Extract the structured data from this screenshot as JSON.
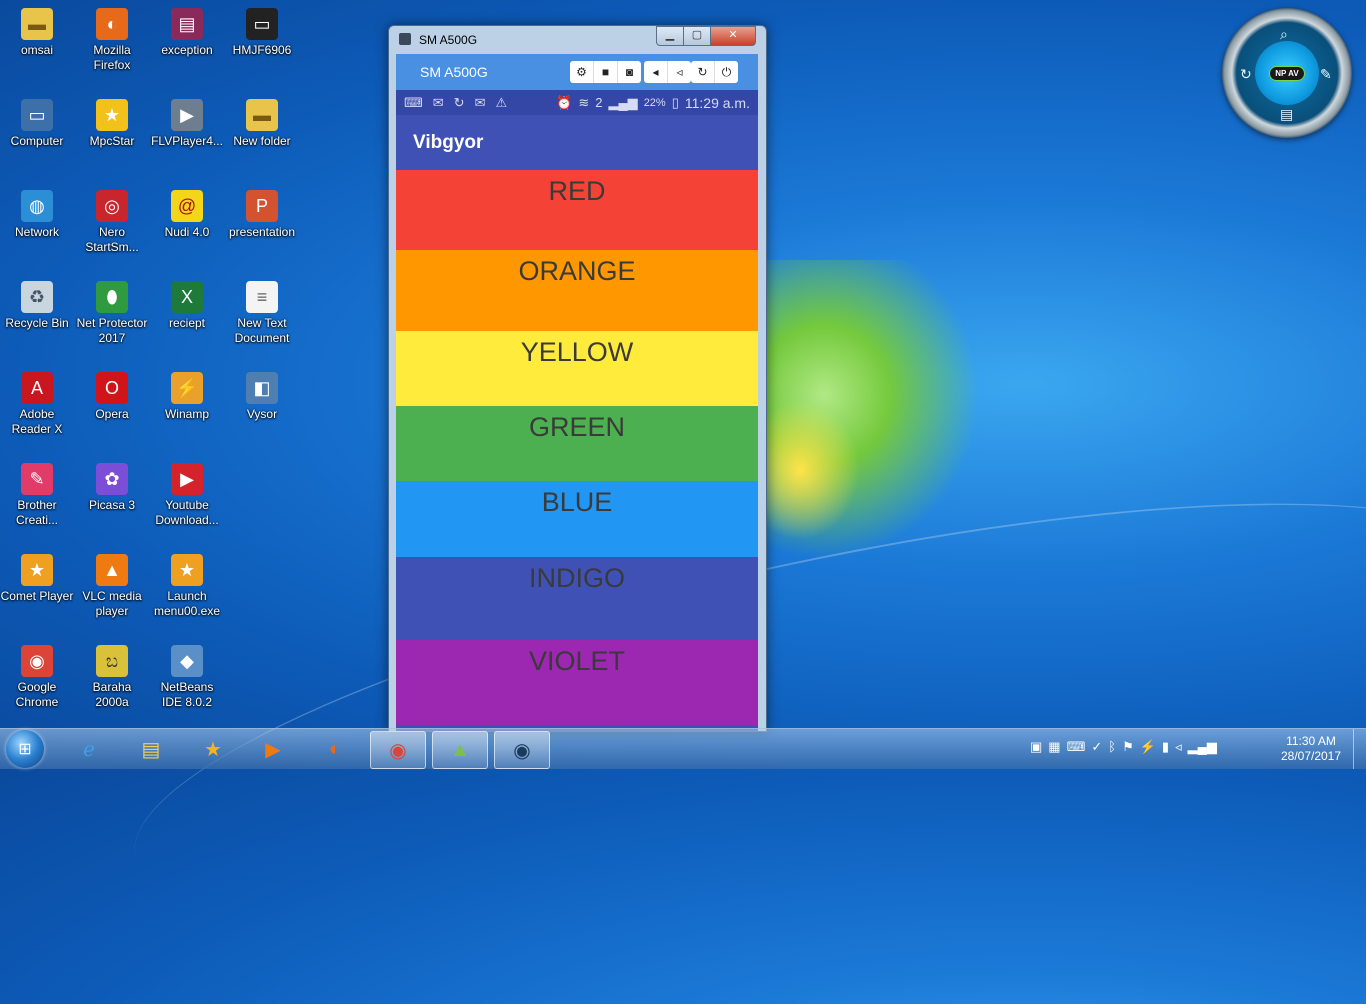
{
  "desktop": {
    "icons": [
      {
        "label": "omsai",
        "icon": "folder-icon"
      },
      {
        "label": "Mozilla Firefox",
        "icon": "firefox-icon"
      },
      {
        "label": "exception",
        "icon": "winrar-icon"
      },
      {
        "label": "HMJF6906",
        "icon": "device-icon"
      },
      {
        "label": "Computer",
        "icon": "computer-icon"
      },
      {
        "label": "MpcStar",
        "icon": "mpcstar-icon"
      },
      {
        "label": "FLVPlayer4...",
        "icon": "flvplayer-icon"
      },
      {
        "label": "New folder",
        "icon": "folder-icon"
      },
      {
        "label": "Network",
        "icon": "network-icon"
      },
      {
        "label": "Nero StartSm...",
        "icon": "nero-icon"
      },
      {
        "label": "Nudi 4.0",
        "icon": "nudi-icon"
      },
      {
        "label": "presentation",
        "icon": "powerpoint-icon"
      },
      {
        "label": "Recycle Bin",
        "icon": "recycle-bin-icon"
      },
      {
        "label": "Net Protector 2017",
        "icon": "net-protector-icon"
      },
      {
        "label": "reciept",
        "icon": "excel-icon"
      },
      {
        "label": "New Text Document",
        "icon": "text-document-icon"
      },
      {
        "label": "Adobe Reader X",
        "icon": "adobe-reader-icon"
      },
      {
        "label": "Opera",
        "icon": "opera-icon"
      },
      {
        "label": "Winamp",
        "icon": "winamp-icon"
      },
      {
        "label": "Vysor",
        "icon": "vysor-icon"
      },
      {
        "label": "Brother Creati...",
        "icon": "brother-icon"
      },
      {
        "label": "Picasa 3",
        "icon": "picasa-icon"
      },
      {
        "label": "Youtube Download...",
        "icon": "youtube-downloader-icon"
      },
      {
        "label": "Comet Player",
        "icon": "comet-player-icon"
      },
      {
        "label": "VLC media player",
        "icon": "vlc-icon"
      },
      {
        "label": "Launch menu00.exe",
        "icon": "launch-icon"
      },
      {
        "label": "Google Chrome",
        "icon": "chrome-icon"
      },
      {
        "label": "Baraha 2000a",
        "icon": "baraha-icon"
      },
      {
        "label": "NetBeans IDE 8.0.2",
        "icon": "netbeans-icon"
      }
    ]
  },
  "window": {
    "title": "SM A500G",
    "min": "▁",
    "max": "▢",
    "close": "✕"
  },
  "vysor": {
    "device_name": "SM A500G"
  },
  "phone": {
    "status": {
      "battery": "22%",
      "time": "11:29 a.m.",
      "sim": "2"
    },
    "app_title": "Vibgyor",
    "bands": [
      {
        "label": "RED",
        "color": "#f44336"
      },
      {
        "label": "ORANGE",
        "color": "#ff9800"
      },
      {
        "label": "YELLOW",
        "color": "#ffeb3b"
      },
      {
        "label": "GREEN",
        "color": "#4caf50"
      },
      {
        "label": "BLUE",
        "color": "#2196f3"
      },
      {
        "label": "INDIGO",
        "color": "#3f51b5"
      },
      {
        "label": "VIOLET",
        "color": "#9c27b0"
      }
    ]
  },
  "gadget": {
    "badge": "NP AV"
  },
  "taskbar": {
    "time": "11:30 AM",
    "date": "28/07/2017"
  }
}
